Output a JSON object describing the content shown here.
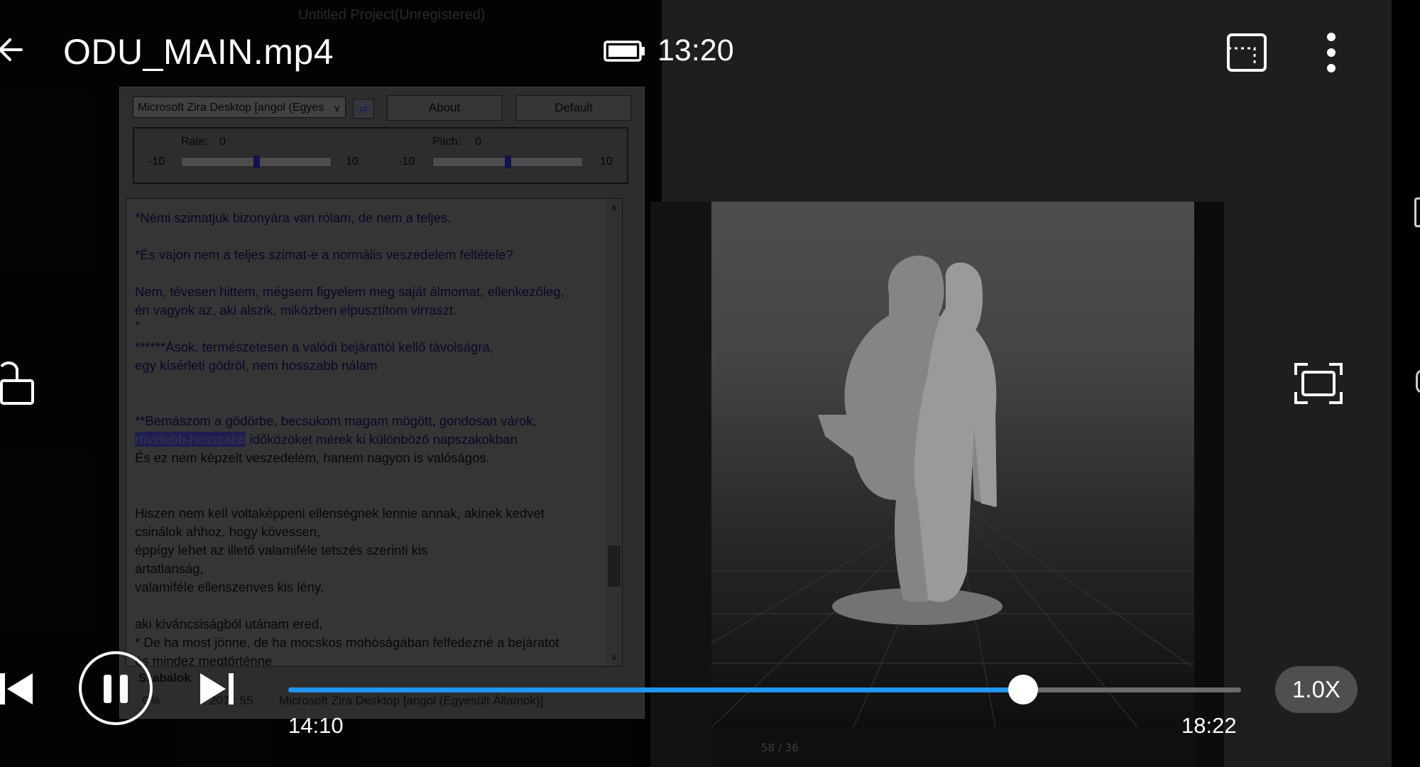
{
  "header": {
    "file_title": "ODU_MAIN.mp4",
    "clock": "13:20",
    "icons": [
      "back-arrow-icon",
      "battery-icon",
      "cast-icon",
      "more-vert-icon"
    ]
  },
  "side_controls": {
    "icons": [
      "lock-open-icon",
      "fit-screen-icon"
    ]
  },
  "playback": {
    "current_time": "14:10",
    "duration": "18:22",
    "progress_fraction": 0.771,
    "speed_label": "1.0X",
    "accent_color": "#2196f3",
    "icons": [
      "skip-previous-icon",
      "pause-icon",
      "skip-next-icon"
    ]
  },
  "video_content": {
    "project_title": "Untitled Project(Unregistered)",
    "tts_app": {
      "voice_select": "Microsoft Zira Desktop [angol (Egyes",
      "about_label": "About",
      "default_label": "Default",
      "rate_label": "Rate:",
      "rate_value": "0",
      "pitch_label": "Pitch:",
      "pitch_value": "0",
      "min_value": "-10",
      "max_value": "10",
      "text_lines": [
        "*Némi szimatjuk bizonyára van rólam, de nem a teljes.",
        "*És vajon nem a teljes szimat-e a normális veszedelem feltétele?",
        "Nem, tévesen hittem, mégsem figyelem meg saját álmomat, ellenkezőleg,",
        "én vagyok az, aki alszik, miközben elpusztítom virraszt.",
        "*",
        "******Ások, természetesen a valódi bejárattól kellő távolságra,",
        "egy kísérleti gödröl, nem hosszabb nálam",
        "**Bemászom a gödörbe, becsukom magam mögött, gondosan várok,",
        "rövidebb-hosszabb",
        "időközöket mérek ki különböző napszakokban",
        "És ez nem képzelt veszedelem, hanem nagyon is valóságos.",
        "Hiszen nem kell voltaképpeni ellenségnek lennie annak, akinek kedvet",
        "csinálok ahhoz, hogy kövessen,",
        "éppígy lehet az illető valamiféle tetszés szerinti kis",
        "ártatlanság,",
        "valamiféle ellenszenves kis lény,",
        "aki kíváncsiságból utánam ered,",
        "* De ha most jönne, de ha mocskos mohóságában felfedezné a bejáratot",
        "és mindez megtörténne"
      ],
      "status_left": "Szabalok",
      "status_pct": "0%",
      "status_pos": "207 : 55",
      "status_voice": "Microsoft Zira Desktop [angol (Egyesült Államok)]"
    },
    "viewer": {
      "frame_counter": "58 / 36"
    }
  }
}
